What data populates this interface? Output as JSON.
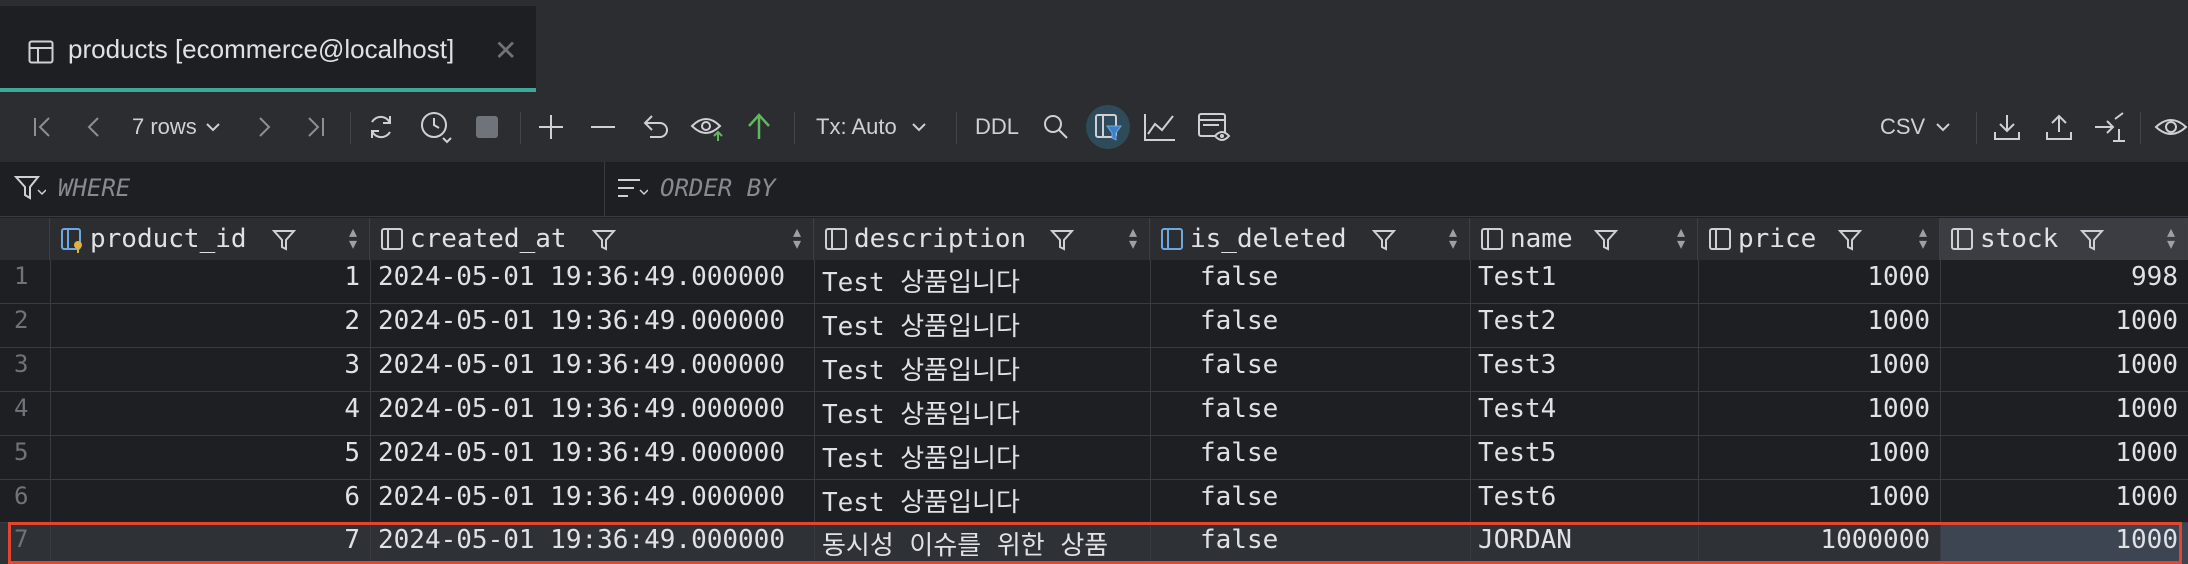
{
  "tab": {
    "title": "products [ecommerce@localhost]"
  },
  "toolbar": {
    "rows_label": "7 rows",
    "tx_label": "Tx: Auto",
    "ddl_label": "DDL",
    "export_format": "CSV"
  },
  "filter": {
    "where": "WHERE",
    "order_by": "ORDER BY"
  },
  "table": {
    "columns": [
      "product_id",
      "created_at",
      "description",
      "is_deleted",
      "name",
      "price",
      "stock"
    ],
    "rows": [
      {
        "n": "1",
        "product_id": "1",
        "created_at": "2024-05-01 19:36:49.000000",
        "description": "Test 상품입니다",
        "is_deleted": "false",
        "name": "Test1",
        "price": "1000",
        "stock": "998"
      },
      {
        "n": "2",
        "product_id": "2",
        "created_at": "2024-05-01 19:36:49.000000",
        "description": "Test 상품입니다",
        "is_deleted": "false",
        "name": "Test2",
        "price": "1000",
        "stock": "1000"
      },
      {
        "n": "3",
        "product_id": "3",
        "created_at": "2024-05-01 19:36:49.000000",
        "description": "Test 상품입니다",
        "is_deleted": "false",
        "name": "Test3",
        "price": "1000",
        "stock": "1000"
      },
      {
        "n": "4",
        "product_id": "4",
        "created_at": "2024-05-01 19:36:49.000000",
        "description": "Test 상품입니다",
        "is_deleted": "false",
        "name": "Test4",
        "price": "1000",
        "stock": "1000"
      },
      {
        "n": "5",
        "product_id": "5",
        "created_at": "2024-05-01 19:36:49.000000",
        "description": "Test 상품입니다",
        "is_deleted": "false",
        "name": "Test5",
        "price": "1000",
        "stock": "1000"
      },
      {
        "n": "6",
        "product_id": "6",
        "created_at": "2024-05-01 19:36:49.000000",
        "description": "Test 상품입니다",
        "is_deleted": "false",
        "name": "Test6",
        "price": "1000",
        "stock": "1000"
      },
      {
        "n": "7",
        "product_id": "7",
        "created_at": "2024-05-01 19:36:49.000000",
        "description": "동시성 이슈를 위한 상품",
        "is_deleted": "false",
        "name": "JORDAN",
        "price": "1000000",
        "stock": "1000"
      }
    ]
  },
  "colors": {
    "accent": "#3fa89b",
    "highlight_border": "#e2462f",
    "background": "#1e1f22"
  }
}
